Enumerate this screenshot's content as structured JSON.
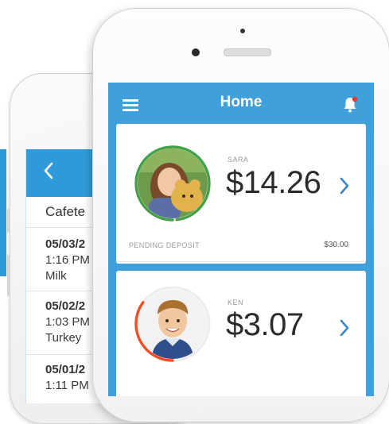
{
  "colors": {
    "brand_blue": "#3fa0dc",
    "progress_green": "#43a047",
    "progress_orange": "#f04e23",
    "notification_dot": "#e53935"
  },
  "back_screen": {
    "title": "Cafete",
    "back_icon": "chevron-left-icon",
    "entries": [
      {
        "date": "05/03/2",
        "time": "1:16 PM",
        "item": "Milk"
      },
      {
        "date": "05/02/2",
        "time": "1:03 PM",
        "item": "Turkey"
      },
      {
        "date": "05/01/2",
        "time": "1:11 PM",
        "item": ""
      }
    ]
  },
  "header": {
    "title": "Home",
    "menu_icon": "hamburger-menu-icon",
    "notification_icon": "bell-icon"
  },
  "kids": [
    {
      "name": "SARA",
      "balance": "$14.26",
      "pending_label": "PENDING DEPOSIT",
      "pending_amount": "$30.00",
      "ring_color": "#43a047",
      "ring_fill": 0.98
    },
    {
      "name": "KEN",
      "balance": "$3.07",
      "ring_color": "#f04e23",
      "ring_fill": 0.35
    }
  ]
}
